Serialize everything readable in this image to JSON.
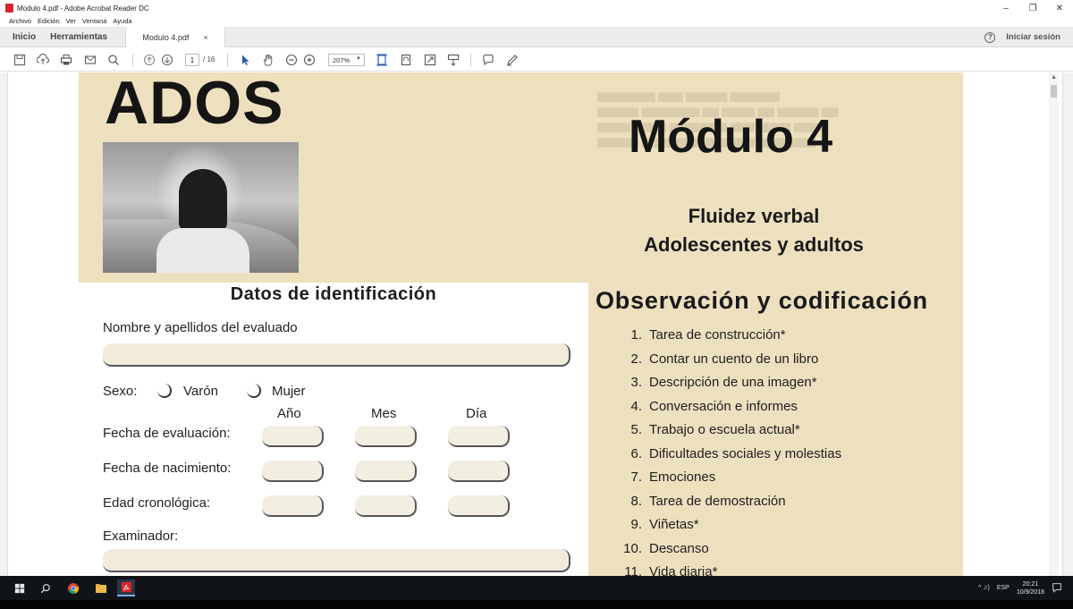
{
  "window": {
    "title": "Modulo 4.pdf - Adobe Acrobat Reader DC",
    "minimize": "–",
    "maximize": "❐",
    "close": "✕"
  },
  "menu": [
    "Archivo",
    "Edición",
    "Ver",
    "Ventana",
    "Ayuda"
  ],
  "tabs": {
    "home": "Inicio",
    "tools": "Herramientas",
    "document": "Modulo 4.pdf",
    "close": "×",
    "sign_in": "Iniciar sesión",
    "help": "?"
  },
  "toolbar": {
    "page_current": "1",
    "page_total": "/ 16",
    "zoom": "207%",
    "icons": [
      "save-icon",
      "cloud-upload-icon",
      "print-icon",
      "email-icon",
      "search-icon",
      "page-up-icon",
      "page-down-icon",
      "select-arrow-icon",
      "hand-icon",
      "zoom-out-icon",
      "zoom-in-icon",
      "fit-page-icon",
      "rotate-icon",
      "fullscreen-icon",
      "scroll-mode-icon",
      "comment-icon",
      "pen-icon"
    ]
  },
  "document": {
    "logo": "ADOS",
    "title": "Módulo 4",
    "subtitle_line1": "Fluidez verbal",
    "subtitle_line2": "Adolescentes y adultos",
    "identification": {
      "heading": "Datos de identificación",
      "name_label": "Nombre y apellidos del evaluado",
      "sex_label": "Sexo:",
      "male_label": "Varón",
      "female_label": "Mujer",
      "col_year": "Año",
      "col_month": "Mes",
      "col_day": "Día",
      "eval_date_label": "Fecha de evaluación:",
      "birth_date_label": "Fecha de nacimiento:",
      "age_label": "Edad cronológica:",
      "examiner_label": "Examinador:"
    },
    "observation": {
      "heading": "Observación y codificación",
      "items": [
        {
          "num": "1.",
          "text": "Tarea de construcción*"
        },
        {
          "num": "2.",
          "text": "Contar un cuento de un libro"
        },
        {
          "num": "3.",
          "text": "Descripción de una imagen*"
        },
        {
          "num": "4.",
          "text": "Conversación e informes"
        },
        {
          "num": "5.",
          "text": "Trabajo o escuela actual*"
        },
        {
          "num": "6.",
          "text": "Dificultades sociales y molestias"
        },
        {
          "num": "7.",
          "text": "Emociones"
        },
        {
          "num": "8.",
          "text": "Tarea de demostración"
        },
        {
          "num": "9.",
          "text": "Viñetas*"
        },
        {
          "num": "10.",
          "text": "Descanso"
        },
        {
          "num": "11.",
          "text": "Vida diaria*"
        }
      ]
    }
  },
  "taskbar": {
    "lang": "ESP",
    "time": "20:21",
    "date": "10/9/2018",
    "tray_text": "^ ♫)"
  },
  "colors": {
    "page_beige": "#ede0bf",
    "acrobat_red": "#d7262b",
    "taskbar": "#101418"
  }
}
